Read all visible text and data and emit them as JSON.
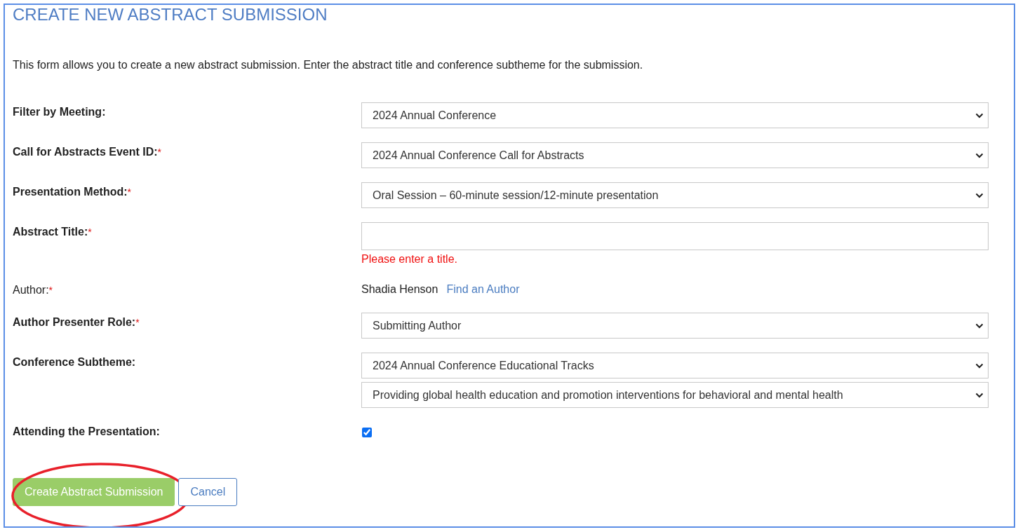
{
  "title": "CREATE NEW ABSTRACT SUBMISSION",
  "description": "This form allows you to create a new abstract submission. Enter the abstract title and conference subtheme for the submission.",
  "fields": [
    {
      "label": "Filter by Meeting:",
      "bold": true,
      "kind": "select",
      "values": [
        "2024 Annual Conference"
      ]
    },
    {
      "label": "Call for Abstracts Event ID:",
      "bold": true,
      "required_mark": "*",
      "kind": "select",
      "values": [
        "2024 Annual Conference Call for Abstracts"
      ]
    },
    {
      "label": "Presentation Method:",
      "bold": true,
      "required_mark": "*",
      "kind": "select",
      "values": [
        "Oral Session – 60-minute session/12-minute presentation"
      ]
    },
    {
      "label": "Abstract Title:",
      "bold": true,
      "required_mark": "*",
      "kind": "input",
      "error": "Please enter a title."
    },
    {
      "label": "Author:",
      "bold": false,
      "required_mark": "*",
      "kind": "author",
      "name": "Shadia Henson",
      "link": "Find an Author"
    },
    {
      "label": "Author Presenter Role:",
      "bold": true,
      "required_mark": "*",
      "kind": "select",
      "values": [
        "Submitting Author"
      ]
    },
    {
      "label": "Conference Subtheme:",
      "bold": true,
      "kind": "select",
      "values": [
        "2024 Annual Conference Educational Tracks",
        "Providing global health education and promotion interventions for behavioral and mental health"
      ]
    },
    {
      "label": "Attending the Presentation:",
      "bold": true,
      "kind": "checkbox",
      "checked": true
    }
  ],
  "buttons": [
    {
      "label": "Create Abstract Submission",
      "kind": "primary",
      "highlighted": true
    },
    {
      "label": "Cancel",
      "kind": "secondary",
      "highlighted": false
    }
  ]
}
